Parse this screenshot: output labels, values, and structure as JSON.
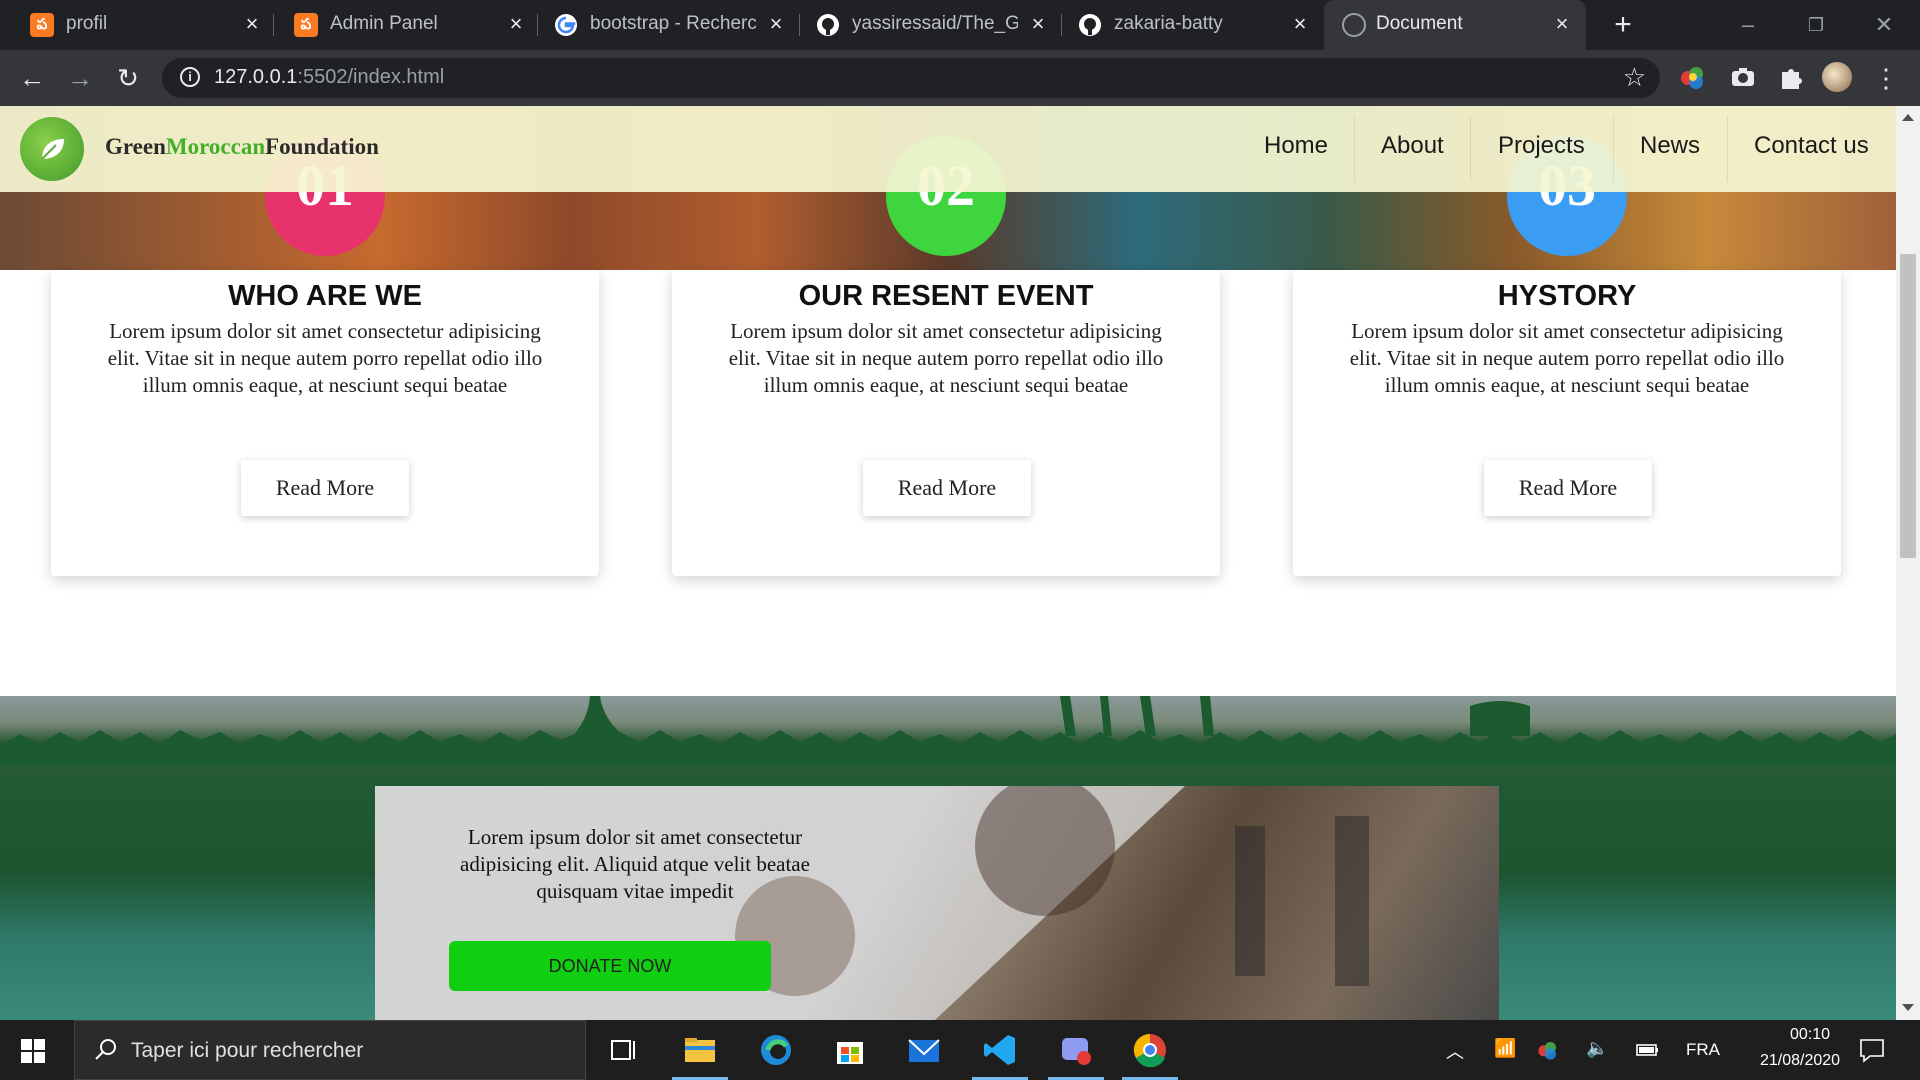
{
  "browser": {
    "tabs": [
      {
        "label": "profil",
        "icon": "xampp-icon"
      },
      {
        "label": "Admin Panel",
        "icon": "xampp-icon"
      },
      {
        "label": "bootstrap - Recherch",
        "icon": "google-icon"
      },
      {
        "label": "yassiressaid/The_Gre",
        "icon": "github-icon"
      },
      {
        "label": "zakaria-batty",
        "icon": "github-icon"
      },
      {
        "label": "Document",
        "icon": "globe-icon",
        "active": true
      }
    ],
    "url_host": "127.0.0.1",
    "url_rest": ":5502/index.html"
  },
  "site": {
    "brand": {
      "part1": "Green",
      "part2": "Moroccan",
      "part3": "Foundation"
    },
    "nav": [
      "Home",
      "About",
      "Projects",
      "News",
      "Contact us"
    ],
    "cards": [
      {
        "number": "01",
        "title": "WHO ARE WE",
        "color": "#e8326c",
        "text": "Lorem ipsum dolor sit amet consectetur adipisicing elit. Vitae sit in neque autem porro repellat odio illo illum omnis eaque, at nesciunt sequi beatae",
        "button": "Read More"
      },
      {
        "number": "02",
        "title": "OUR RESENT EVENT",
        "color": "#3ed53e",
        "text": "Lorem ipsum dolor sit amet consectetur adipisicing elit. Vitae sit in neque autem porro repellat odio illo illum omnis eaque, at nesciunt sequi beatae",
        "button": "Read More"
      },
      {
        "number": "03",
        "title": "HYSTORY",
        "color": "#3a9cf2",
        "text": "Lorem ipsum dolor sit amet consectetur adipisicing elit. Vitae sit in neque autem porro repellat odio illo illum omnis eaque, at nesciunt sequi beatae",
        "button": "Read More"
      }
    ],
    "donate": {
      "text": "Lorem ipsum dolor sit amet consectetur adipisicing elit. Aliquid atque velit beatae quisquam vitae impedit",
      "button": "DONATE NOW"
    }
  },
  "taskbar": {
    "search_placeholder": "Taper ici pour rechercher",
    "language": "FRA",
    "time": "00:10",
    "date": "21/08/2020"
  }
}
